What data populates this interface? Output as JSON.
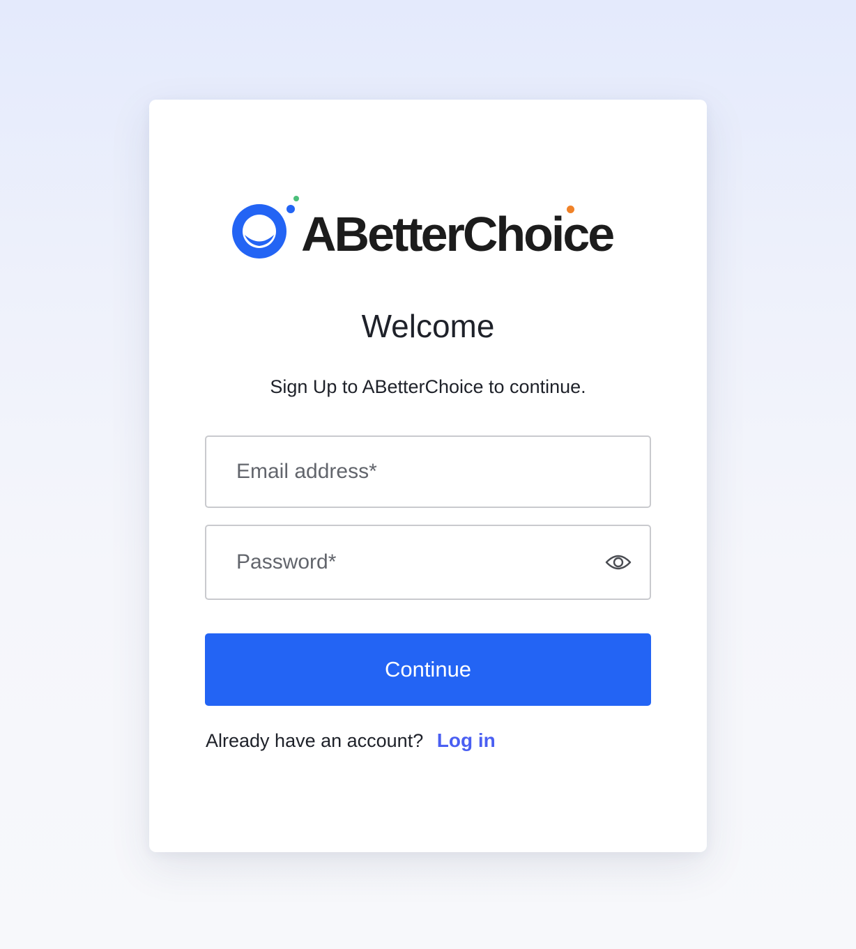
{
  "brand": {
    "name": "ABetterChoice",
    "mark_colors": {
      "ring": "#2364f4",
      "dot_green": "#4bbf7a",
      "dot_orange": "#f08228"
    },
    "icon": "abetterchoice-logo-icon"
  },
  "title": "Welcome",
  "subtitle": "Sign Up to ABetterChoice to continue.",
  "form": {
    "email": {
      "placeholder": "Email address*",
      "value": ""
    },
    "password": {
      "placeholder": "Password*",
      "value": "",
      "toggle_icon": "eye-icon"
    },
    "submit_label": "Continue"
  },
  "footer": {
    "prompt": "Already have an account?",
    "link_label": "Log in"
  },
  "colors": {
    "primary": "#2364f4",
    "link": "#4a5ff2",
    "text": "#1e2129"
  }
}
